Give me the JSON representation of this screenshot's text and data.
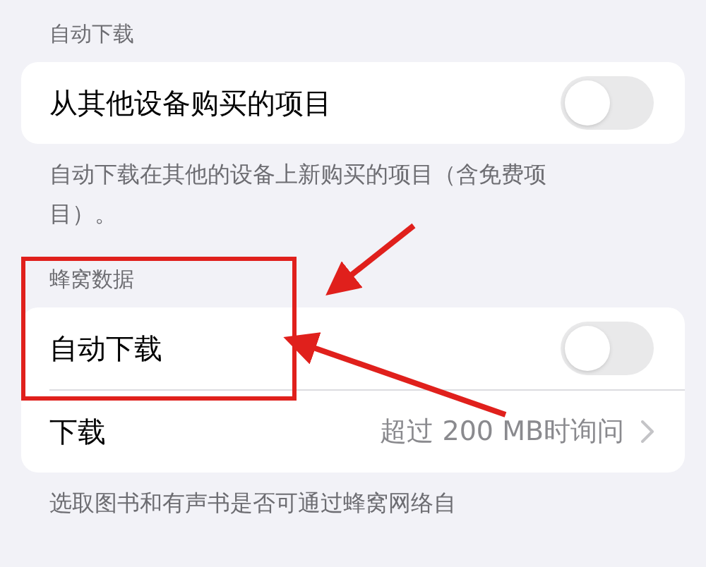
{
  "sections": [
    {
      "header": "自动下载",
      "rows": [
        {
          "kind": "toggle",
          "label": "从其他设备购买的项目",
          "on": false
        }
      ],
      "footer": "自动下载在其他的设备上新购买的项目（含免费项目）。"
    },
    {
      "header": "蜂窝数据",
      "rows": [
        {
          "kind": "toggle",
          "label": "自动下载",
          "on": false
        },
        {
          "kind": "link",
          "label": "下载",
          "value": "超过 200 MB时询问"
        }
      ],
      "footer": "选取图书和有声书是否可通过蜂窝网络自"
    }
  ]
}
